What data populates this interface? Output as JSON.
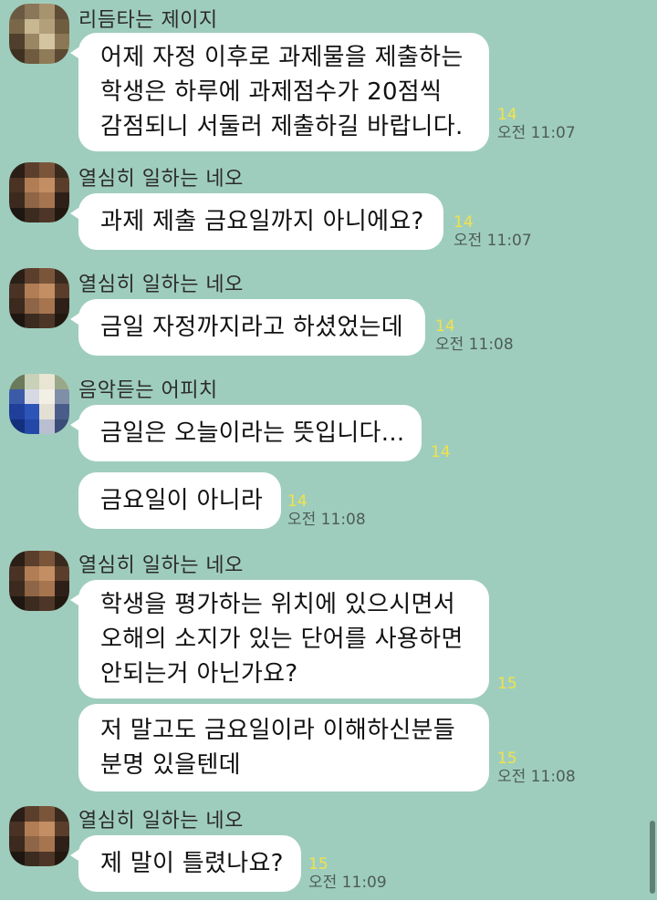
{
  "colors": {
    "background": "#9fcdbd",
    "bubble": "#ffffff",
    "unread_count": "#f1e24a",
    "time": "#4d5c57"
  },
  "messages": [
    {
      "sender": "리듬타는 제이지",
      "lines": [
        "어제 자정 이후로 과제물을 제출하는",
        "학생은 하루에 과제점수가 20점씩",
        "감점되니 서둘러 제출하길 바랍니다."
      ],
      "count": "14",
      "time": "오전 11:07"
    },
    {
      "sender": "열심히 일하는 네오",
      "lines": [
        "과제 제출 금요일까지 아니에요?"
      ],
      "count": "14",
      "time": "오전 11:07"
    },
    {
      "sender": "열심히 일하는 네오",
      "lines": [
        "금일 자정까지라고 하셨었는데"
      ],
      "count": "14",
      "time": "오전 11:08"
    },
    {
      "sender": "음악듣는 어피치",
      "lines": [
        "금일은 오늘이라는 뜻입니다..."
      ],
      "count": "14",
      "time": ""
    },
    {
      "sender": "",
      "lines": [
        "금요일이 아니라"
      ],
      "count": "14",
      "time": "오전 11:08"
    },
    {
      "sender": "열심히 일하는 네오",
      "lines": [
        "학생을 평가하는 위치에 있으시면서",
        "오해의 소지가 있는 단어를 사용하면",
        "안되는거 아닌가요?"
      ],
      "count": "15",
      "time": ""
    },
    {
      "sender": "",
      "lines": [
        "저 말고도 금요일이라 이해하신분들",
        "분명 있을텐데"
      ],
      "count": "15",
      "time": "오전 11:08"
    },
    {
      "sender": "열심히 일하는 네오",
      "lines": [
        "제 말이 틀렸나요?"
      ],
      "count": "15",
      "time": "오전 11:09"
    }
  ],
  "avatars": [
    {
      "icon": "jayg-avatar-icon",
      "palette": [
        "#6b5a43",
        "#8a7658",
        "#a8936f",
        "#5e4c36",
        "#7a6749",
        "#c9b792",
        "#b3a07b",
        "#6f5d42",
        "#4f3f2c",
        "#9a8663",
        "#d4c4a0",
        "#8b7755",
        "#3f3122",
        "#6e5b40",
        "#8f7b58",
        "#5b4932"
      ]
    },
    {
      "icon": "neo-avatar-icon",
      "palette": [
        "#2a1e16",
        "#5b3f2c",
        "#7a553a",
        "#3a2a1e",
        "#4a3324",
        "#b07d55",
        "#c38e63",
        "#5a3e2b",
        "#3b2a1d",
        "#8e6546",
        "#a6754f",
        "#2e2018",
        "#1e1611",
        "#3c2b1f",
        "#4d3627",
        "#22180f"
      ]
    },
    {
      "icon": "neo-avatar-icon",
      "palette": [
        "#2a1e16",
        "#5b3f2c",
        "#7a553a",
        "#3a2a1e",
        "#4a3324",
        "#b07d55",
        "#c38e63",
        "#5a3e2b",
        "#3b2a1d",
        "#8e6546",
        "#a6754f",
        "#2e2018",
        "#1e1611",
        "#3c2b1f",
        "#4d3627",
        "#22180f"
      ]
    },
    {
      "icon": "apeach-avatar-icon",
      "palette": [
        "#6b7a5a",
        "#c9d1b8",
        "#e8e6d2",
        "#9aa88a",
        "#3b5aa8",
        "#d6d9e4",
        "#f2efe5",
        "#7f8fa8",
        "#1f3f9a",
        "#2d55b8",
        "#e3dfd3",
        "#4a5d8a",
        "#14307d",
        "#2348a8",
        "#b9bfd0",
        "#3a4c78"
      ]
    },
    {
      "icon": "neo-avatar-icon",
      "palette": [
        "#2a1e16",
        "#5b3f2c",
        "#7a553a",
        "#3a2a1e",
        "#4a3324",
        "#b07d55",
        "#c38e63",
        "#5a3e2b",
        "#3b2a1d",
        "#8e6546",
        "#a6754f",
        "#2e2018",
        "#1e1611",
        "#3c2b1f",
        "#4d3627",
        "#22180f"
      ]
    },
    {
      "icon": "neo-avatar-icon",
      "palette": [
        "#2a1e16",
        "#5b3f2c",
        "#7a553a",
        "#3a2a1e",
        "#4a3324",
        "#b07d55",
        "#c38e63",
        "#5a3e2b",
        "#3b2a1d",
        "#8e6546",
        "#a6754f",
        "#2e2018",
        "#1e1611",
        "#3c2b1f",
        "#4d3627",
        "#22180f"
      ]
    }
  ]
}
